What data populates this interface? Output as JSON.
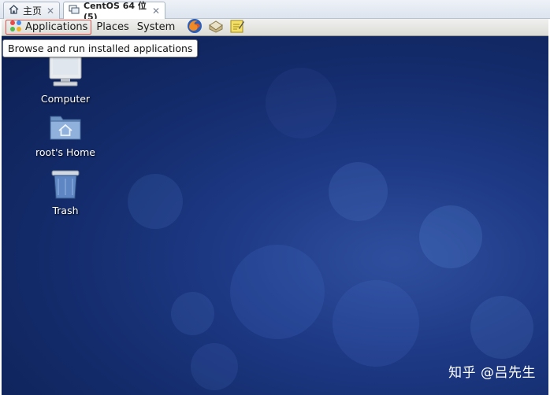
{
  "tabs": [
    {
      "label": "主页",
      "icon": "home-icon"
    },
    {
      "label": "CentOS 64 位 (5)",
      "icon": "vm-icon"
    }
  ],
  "panel": {
    "menus": [
      "Applications",
      "Places",
      "System"
    ],
    "launchers": [
      "firefox-icon",
      "mail-client-icon",
      "notes-icon"
    ]
  },
  "tooltip": "Browse and run installed applications",
  "desktop": {
    "icons": [
      {
        "label": "Computer",
        "icon": "computer-icon"
      },
      {
        "label": "root's Home",
        "icon": "home-folder-icon"
      },
      {
        "label": "Trash",
        "icon": "trash-icon"
      }
    ]
  },
  "watermark": "知乎 @吕先生",
  "colors": {
    "desktop_bg": "#1e3a86",
    "highlight_border": "#d9534f",
    "panel_bg": "#e6e6e3"
  }
}
